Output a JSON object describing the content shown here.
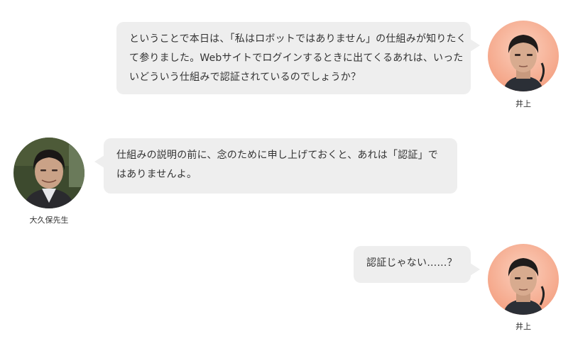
{
  "messages": [
    {
      "speaker": "井上",
      "side": "right",
      "lines": [
        "ということで本日は、「私はロボットではありません」の仕組みが知りたく",
        "て参りました。Webサイトでログインするときに出てくるあれは、いった",
        "いどういう仕組みで認証されているのでしょうか？"
      ]
    },
    {
      "speaker": "大久保先生",
      "side": "left",
      "lines": [
        "仕組みの説明の前に、念のために申し上げておくと、あれは「認証」で",
        "はありませんよ。"
      ]
    },
    {
      "speaker": "井上",
      "side": "right",
      "lines": [
        "認証じゃない……？"
      ]
    }
  ],
  "colors": {
    "bubble": "#eeeeee",
    "text": "#333333",
    "inoue_bg": "#f6a98c",
    "okubo_bg": "#3d4a2e"
  },
  "icons": {
    "inoue": "person-avatar-icon",
    "okubo": "person-avatar-icon"
  }
}
